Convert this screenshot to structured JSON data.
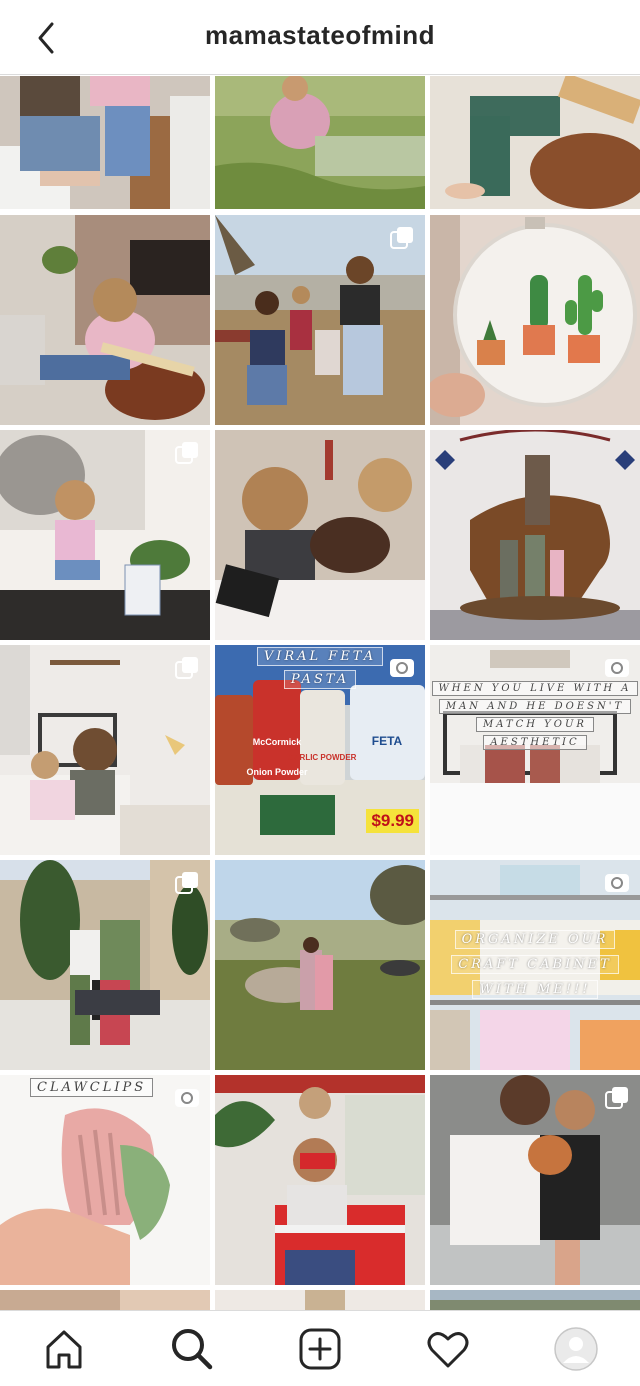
{
  "header": {
    "username": "mamastateofmind",
    "back_icon": "chevron-left-icon"
  },
  "posts": [
    {
      "id": "p1",
      "kind": "image"
    },
    {
      "id": "p2",
      "kind": "image"
    },
    {
      "id": "p3",
      "kind": "image"
    },
    {
      "id": "p4",
      "kind": "image"
    },
    {
      "id": "p5",
      "kind": "carousel"
    },
    {
      "id": "p6",
      "kind": "image"
    },
    {
      "id": "p7",
      "kind": "carousel"
    },
    {
      "id": "p8",
      "kind": "image"
    },
    {
      "id": "p9",
      "kind": "image"
    },
    {
      "id": "p10",
      "kind": "carousel"
    },
    {
      "id": "p11",
      "kind": "video",
      "overlay": [
        "VIRAL FETA",
        "PASTA"
      ],
      "labels": {
        "jar1": "McCormick",
        "jar2": "Onion Powder",
        "jar3": "GARLIC POWDER",
        "cheese": "FETA",
        "price": "$9.99"
      }
    },
    {
      "id": "p12",
      "kind": "video",
      "overlay": [
        "WHEN YOU LIVE WITH A",
        "MAN AND HE DOESN'T",
        "MATCH YOUR",
        "AESTHETIC"
      ]
    },
    {
      "id": "p13",
      "kind": "carousel"
    },
    {
      "id": "p14",
      "kind": "image"
    },
    {
      "id": "p15",
      "kind": "video",
      "overlay": [
        "ORGANIZE OUR",
        "CRAFT CABINET",
        "WITH ME!!!"
      ]
    },
    {
      "id": "p16",
      "kind": "video",
      "overlay": [
        "CLAWCLIPS"
      ]
    },
    {
      "id": "p17",
      "kind": "image"
    },
    {
      "id": "p18",
      "kind": "carousel"
    }
  ],
  "tabbar": {
    "items": [
      "home-icon",
      "search-icon",
      "new-post-icon",
      "activity-heart-icon",
      "profile-avatar-icon"
    ],
    "active": "search-icon"
  },
  "colors": {
    "text": "#262626",
    "divider": "#dbdbdb",
    "background": "#ffffff"
  }
}
